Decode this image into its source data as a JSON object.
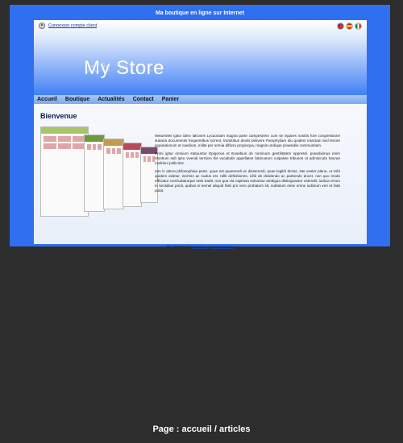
{
  "window": {
    "title": "Ma boutique en ligne sur Internet"
  },
  "header": {
    "login_link": "Connexion compte client",
    "store_name": "My Store",
    "flags": [
      "uk-flag-icon",
      "spain-flag-icon",
      "italy-flag-icon"
    ]
  },
  "nav": {
    "items": [
      {
        "label": "Accueil"
      },
      {
        "label": "Boutique"
      },
      {
        "label": "Actualités"
      },
      {
        "label": "Contact"
      },
      {
        "label": "Panier"
      }
    ]
  },
  "main": {
    "title": "Bienvenue",
    "paragraphs": [
      "Metuentes igitur idem latrones Lycaoniam magna parte campestrem cum se inpares nostris fore congressione stataria documentis frequentibus scirent, tramitibus deviis petivere Pamphyliam diu quidem intactam sed timore populationum et caedium, milite per omnia diffuso propinqua, magnis undique praesidiis communitam.",
      "Primi igitur omnium statuuntur Epigonus et Eusebius ob nominum gentilitatem oppressi. praediximus enim Montium sub ipso vivendi termino his vocabulis appellatos fabricarum culpasse tribunos ut adminicula futurae molitioni pollicitos.",
      "Iam in altera philosophiae parte. quae est quaerendi ac disserendi, quae logikh dicitur, iste vester plane, ut mihi quidem videtur, inermis ac nudus est. tollit definitiones, nihil de dividendo ac partiendo docet, non quo modo efficiatur concludaturque ratio tradit, non qua via captiosa solvantur ambigua distinguantur ostendit; iudicia rerum in sensibus ponit, quibus si semel aliquid falsi pro vero probatum sit, sublatum esse omne iudicium veri et falsi putat."
    ]
  },
  "footer": {
    "prefix": "Site hébergé par",
    "link1": "Webcartop",
    "separator": " - ",
    "link2": "Mentions légales"
  },
  "caption": "Page : accueil / articles"
}
